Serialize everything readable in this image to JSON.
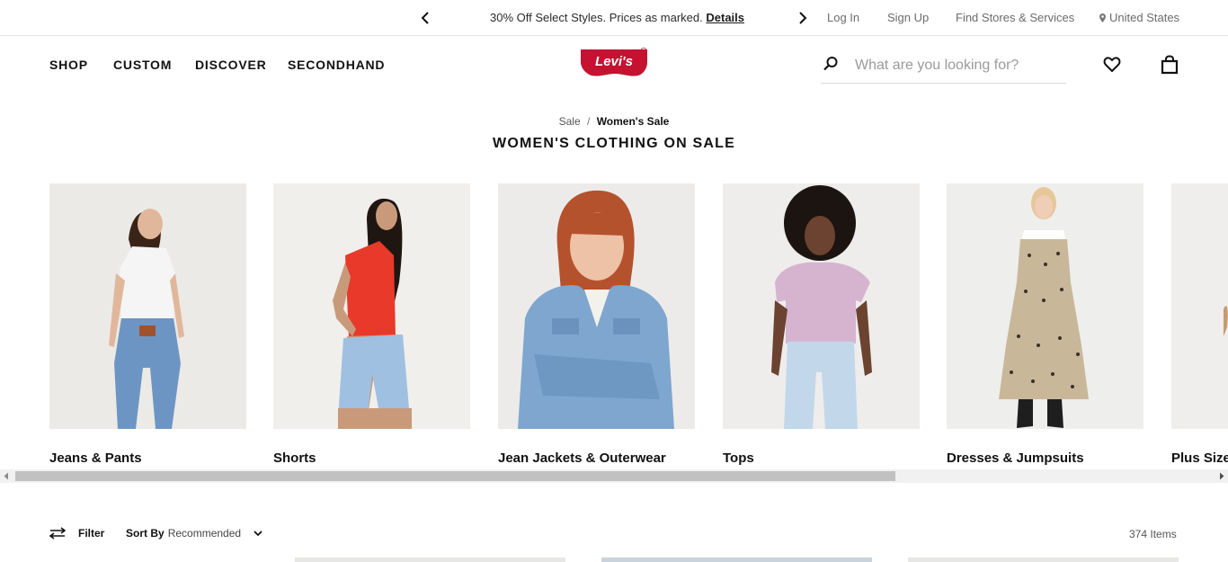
{
  "promo": {
    "text": "30% Off Select Styles. Prices as marked.",
    "link": "Details"
  },
  "utility": {
    "login": "Log In",
    "signup": "Sign Up",
    "stores": "Find Stores & Services",
    "country": "United States"
  },
  "nav": {
    "shop": "SHOP",
    "custom": "CUSTOM",
    "discover": "DISCOVER",
    "secondhand": "SECONDHAND"
  },
  "logo_text": "Levi's",
  "search": {
    "placeholder": "What are you looking for?"
  },
  "breadcrumb": {
    "parent": "Sale",
    "separator": "/",
    "current": "Women's Sale"
  },
  "page_title": "WOMEN'S CLOTHING ON SALE",
  "categories": [
    {
      "label": "Jeans & Pants"
    },
    {
      "label": "Shorts"
    },
    {
      "label": "Jean Jackets & Outerwear"
    },
    {
      "label": "Tops"
    },
    {
      "label": "Dresses & Jumpsuits"
    },
    {
      "label": "Plus Size"
    }
  ],
  "filter_bar": {
    "filter_label": "Filter",
    "sort_label": "Sort By",
    "sort_value": "Recommended",
    "item_count": "374 Items"
  },
  "colors": {
    "brand_red": "#c41230",
    "text": "#1c1c1c"
  }
}
